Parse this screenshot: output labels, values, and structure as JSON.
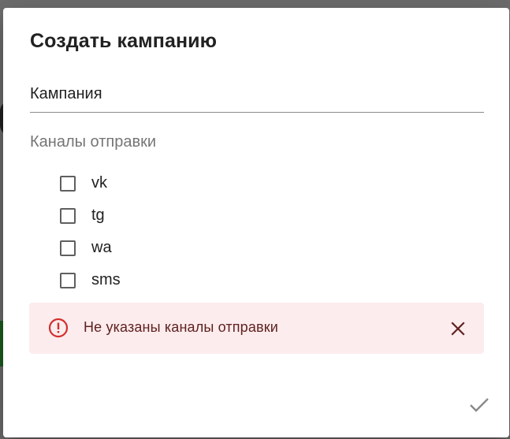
{
  "dialog": {
    "title": "Создать кампанию",
    "campaign_field": {
      "value": "Кампания",
      "placeholder": ""
    },
    "channels_label": "Каналы отправки",
    "channels": [
      {
        "label": "vk",
        "checked": false
      },
      {
        "label": "tg",
        "checked": false
      },
      {
        "label": "wa",
        "checked": false
      },
      {
        "label": "sms",
        "checked": false
      }
    ],
    "alert": {
      "message": "Не указаны каналы отправки",
      "icon": "error-outline-icon",
      "close_icon": "close-icon",
      "color": "#d32f2f",
      "background": "#fdeced"
    },
    "confirm_icon": "check-icon"
  }
}
